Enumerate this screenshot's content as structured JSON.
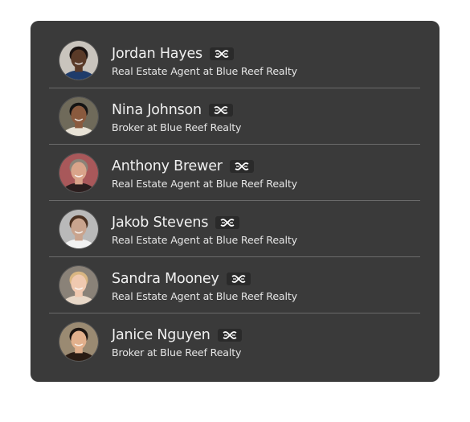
{
  "agents": [
    {
      "name": "Jordan Hayes",
      "subtitle": "Real Estate Agent at Blue Reef Realty",
      "badge_icon": "brokerage-logo-icon",
      "avatar": {
        "skin": "#5a3a28",
        "hair": "#1a1210",
        "shirt": "#1f3c6b",
        "bg": "#c9c4bd"
      }
    },
    {
      "name": "Nina Johnson",
      "subtitle": "Broker at Blue Reef Realty",
      "badge_icon": "brokerage-logo-icon",
      "avatar": {
        "skin": "#8a5a3e",
        "hair": "#141414",
        "shirt": "#e8e2d6",
        "bg": "#6f6a5a"
      }
    },
    {
      "name": "Anthony Brewer",
      "subtitle": "Real Estate Agent at Blue Reef Realty",
      "badge_icon": "brokerage-logo-icon",
      "avatar": {
        "skin": "#d9a48a",
        "hair": "#8b8378",
        "shirt": "#2a1e1e",
        "bg": "#a8585a"
      }
    },
    {
      "name": "Jakob Stevens",
      "subtitle": "Real Estate Agent at Blue Reef Realty",
      "badge_icon": "brokerage-logo-icon",
      "avatar": {
        "skin": "#c9a48e",
        "hair": "#4a3020",
        "shirt": "#f2f2f2",
        "bg": "#b9b9b9"
      }
    },
    {
      "name": "Sandra Mooney",
      "subtitle": "Real Estate Agent at Blue Reef Realty",
      "badge_icon": "brokerage-logo-icon",
      "avatar": {
        "skin": "#f0c9b0",
        "hair": "#d9b682",
        "shirt": "#e8d8c8",
        "bg": "#8a8278"
      }
    },
    {
      "name": "Janice Nguyen",
      "subtitle": "Broker at Blue Reef Realty",
      "badge_icon": "brokerage-logo-icon",
      "avatar": {
        "skin": "#e2b08c",
        "hair": "#1c1410",
        "shirt": "#2a1c14",
        "bg": "#9a8a72"
      }
    }
  ],
  "colors": {
    "card_background": "#3a3a3a",
    "divider": "#6a6a6a",
    "name_text": "#f0f0f0",
    "subtitle_text": "#e6e6e6",
    "badge_background": "#2a2a2a"
  }
}
